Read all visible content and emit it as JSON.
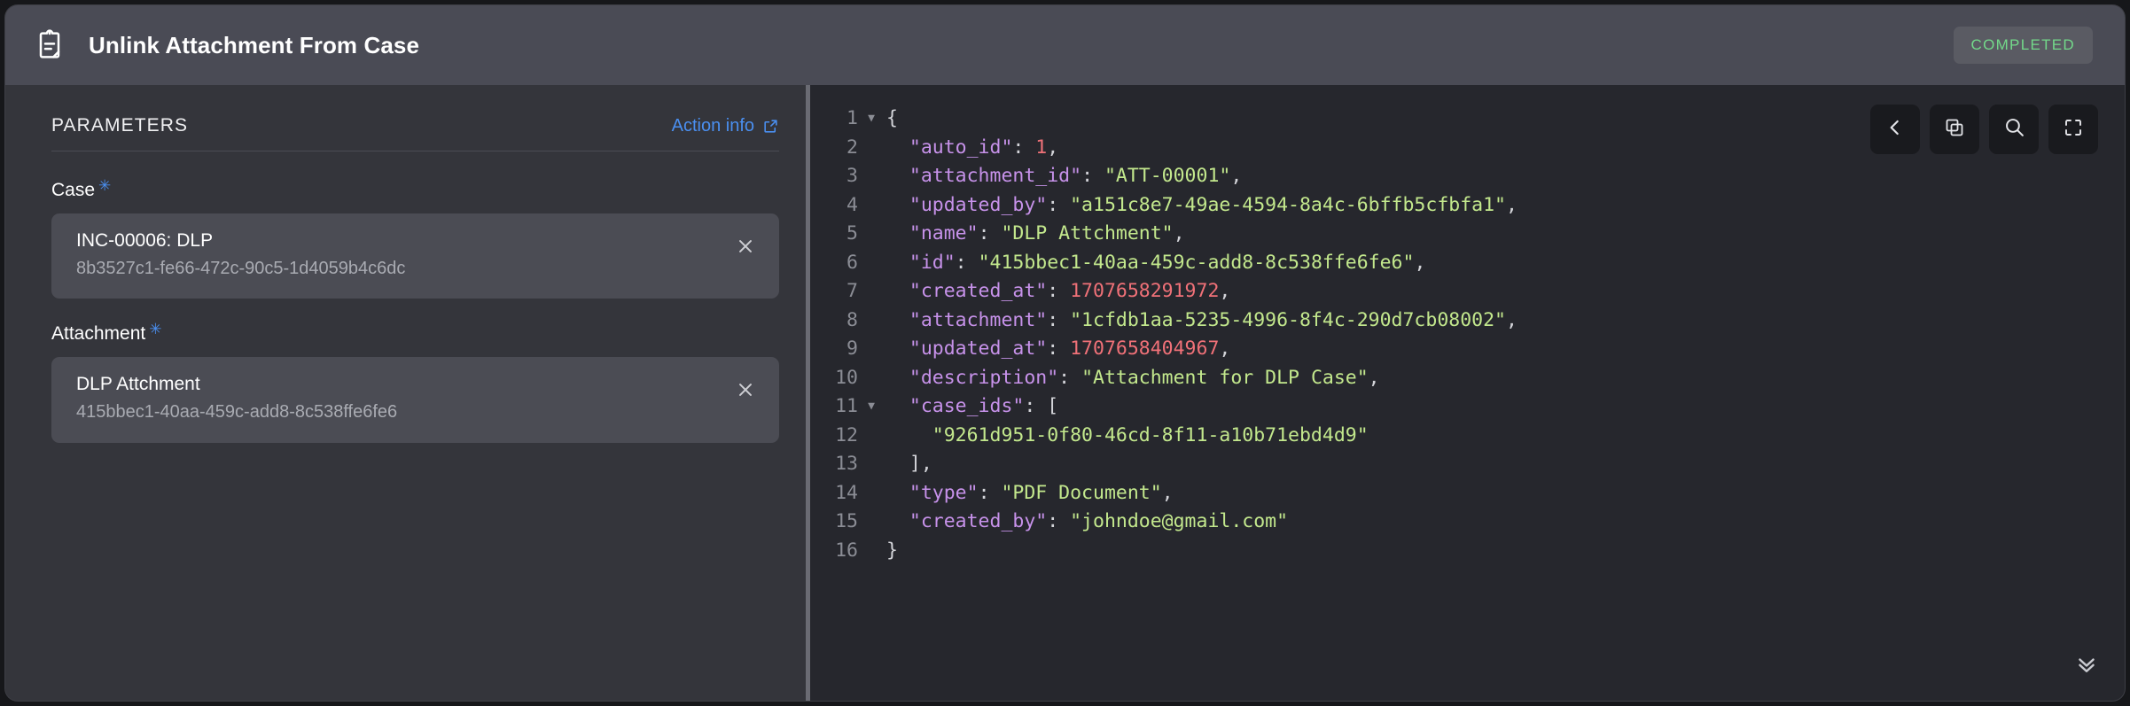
{
  "header": {
    "icon": "clipboard-document-icon",
    "title": "Unlink Attachment From Case",
    "status": "COMPLETED",
    "status_color": "#73d98a"
  },
  "parameters_panel": {
    "section_title": "PARAMETERS",
    "action_info_label": "Action info",
    "action_info_icon": "external-link-icon",
    "accent_color": "#4a8ff0",
    "fields": [
      {
        "label": "Case",
        "required": true,
        "required_marker": "✳",
        "primary": "INC-00006: DLP",
        "secondary": "8b3527c1-fe66-472c-90c5-1d4059b4c6dc",
        "clear_icon": "close-icon"
      },
      {
        "label": "Attachment",
        "required": true,
        "required_marker": "✳",
        "primary": "DLP Attchment",
        "secondary": "415bbec1-40aa-459c-add8-8c538ffe6fe6",
        "clear_icon": "close-icon"
      }
    ]
  },
  "code_panel": {
    "language": "json",
    "toolbar": [
      {
        "name": "collapse-button",
        "icon": "chevron-left-icon"
      },
      {
        "name": "copy-button",
        "icon": "copy-icon"
      },
      {
        "name": "search-button",
        "icon": "search-icon"
      },
      {
        "name": "fullscreen-button",
        "icon": "fullscreen-icon"
      }
    ],
    "expand_icon": "double-chevron-down-icon",
    "lines": [
      {
        "n": "1",
        "fold": "▼",
        "tokens": [
          {
            "t": "{",
            "c": "tk-punc"
          }
        ]
      },
      {
        "n": "2",
        "fold": "",
        "tokens": [
          {
            "t": "  \"auto_id\"",
            "c": "tk-key"
          },
          {
            "t": ": ",
            "c": "tk-punc"
          },
          {
            "t": "1",
            "c": "tk-num"
          },
          {
            "t": ",",
            "c": "tk-punc"
          }
        ]
      },
      {
        "n": "3",
        "fold": "",
        "tokens": [
          {
            "t": "  \"attachment_id\"",
            "c": "tk-key"
          },
          {
            "t": ": ",
            "c": "tk-punc"
          },
          {
            "t": "\"ATT-00001\"",
            "c": "tk-str"
          },
          {
            "t": ",",
            "c": "tk-punc"
          }
        ]
      },
      {
        "n": "4",
        "fold": "",
        "tokens": [
          {
            "t": "  \"updated_by\"",
            "c": "tk-key"
          },
          {
            "t": ": ",
            "c": "tk-punc"
          },
          {
            "t": "\"a151c8e7-49ae-4594-8a4c-6bffb5cfbfa1\"",
            "c": "tk-str"
          },
          {
            "t": ",",
            "c": "tk-punc"
          }
        ]
      },
      {
        "n": "5",
        "fold": "",
        "tokens": [
          {
            "t": "  \"name\"",
            "c": "tk-key"
          },
          {
            "t": ": ",
            "c": "tk-punc"
          },
          {
            "t": "\"DLP Attchment\"",
            "c": "tk-str"
          },
          {
            "t": ",",
            "c": "tk-punc"
          }
        ]
      },
      {
        "n": "6",
        "fold": "",
        "tokens": [
          {
            "t": "  \"id\"",
            "c": "tk-key"
          },
          {
            "t": ": ",
            "c": "tk-punc"
          },
          {
            "t": "\"415bbec1-40aa-459c-add8-8c538ffe6fe6\"",
            "c": "tk-str"
          },
          {
            "t": ",",
            "c": "tk-punc"
          }
        ]
      },
      {
        "n": "7",
        "fold": "",
        "tokens": [
          {
            "t": "  \"created_at\"",
            "c": "tk-key"
          },
          {
            "t": ": ",
            "c": "tk-punc"
          },
          {
            "t": "1707658291972",
            "c": "tk-num"
          },
          {
            "t": ",",
            "c": "tk-punc"
          }
        ]
      },
      {
        "n": "8",
        "fold": "",
        "tokens": [
          {
            "t": "  \"attachment\"",
            "c": "tk-key"
          },
          {
            "t": ": ",
            "c": "tk-punc"
          },
          {
            "t": "\"1cfdb1aa-5235-4996-8f4c-290d7cb08002\"",
            "c": "tk-str"
          },
          {
            "t": ",",
            "c": "tk-punc"
          }
        ]
      },
      {
        "n": "9",
        "fold": "",
        "tokens": [
          {
            "t": "  \"updated_at\"",
            "c": "tk-key"
          },
          {
            "t": ": ",
            "c": "tk-punc"
          },
          {
            "t": "1707658404967",
            "c": "tk-num"
          },
          {
            "t": ",",
            "c": "tk-punc"
          }
        ]
      },
      {
        "n": "10",
        "fold": "",
        "tokens": [
          {
            "t": "  \"description\"",
            "c": "tk-key"
          },
          {
            "t": ": ",
            "c": "tk-punc"
          },
          {
            "t": "\"Attachment for DLP Case\"",
            "c": "tk-str"
          },
          {
            "t": ",",
            "c": "tk-punc"
          }
        ]
      },
      {
        "n": "11",
        "fold": "▼",
        "tokens": [
          {
            "t": "  \"case_ids\"",
            "c": "tk-key"
          },
          {
            "t": ": [",
            "c": "tk-punc"
          }
        ]
      },
      {
        "n": "12",
        "fold": "",
        "tokens": [
          {
            "t": "    ",
            "c": "tk-punc"
          },
          {
            "t": "\"9261d951-0f80-46cd-8f11-a10b71ebd4d9\"",
            "c": "tk-str"
          }
        ]
      },
      {
        "n": "13",
        "fold": "",
        "tokens": [
          {
            "t": "  ],",
            "c": "tk-punc"
          }
        ]
      },
      {
        "n": "14",
        "fold": "",
        "tokens": [
          {
            "t": "  \"type\"",
            "c": "tk-key"
          },
          {
            "t": ": ",
            "c": "tk-punc"
          },
          {
            "t": "\"PDF Document\"",
            "c": "tk-str"
          },
          {
            "t": ",",
            "c": "tk-punc"
          }
        ]
      },
      {
        "n": "15",
        "fold": "",
        "tokens": [
          {
            "t": "  \"created_by\"",
            "c": "tk-key"
          },
          {
            "t": ": ",
            "c": "tk-punc"
          },
          {
            "t": "\"johndoe@gmail.com\"",
            "c": "tk-str"
          }
        ]
      },
      {
        "n": "16",
        "fold": "",
        "tokens": [
          {
            "t": "}",
            "c": "tk-punc"
          }
        ]
      }
    ]
  }
}
